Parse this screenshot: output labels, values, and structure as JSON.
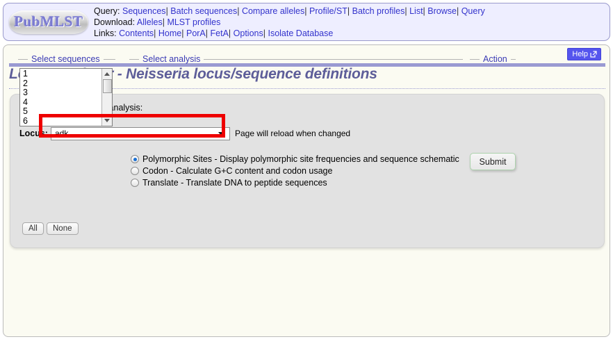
{
  "header": {
    "logo_text": "PubMLST",
    "rows": [
      {
        "label": "Query:",
        "links": [
          "Sequences",
          "Batch sequences",
          "Compare alleles",
          "Profile/ST",
          "Batch profiles",
          "List",
          "Browse",
          "Query"
        ]
      },
      {
        "label": "Download:",
        "links": [
          "Alleles",
          "MLST profiles"
        ]
      },
      {
        "label": "Links:",
        "links": [
          "Contents",
          "Home",
          "PorA",
          "FetA",
          "Options",
          "Isolate Database"
        ]
      }
    ],
    "separator": "|"
  },
  "help": {
    "label": "Help",
    "icon": "external-link-icon"
  },
  "page": {
    "title": "Locus Explorer - Neisseria locus/sequence definitions"
  },
  "form": {
    "instruction": "Please select locus for analysis:",
    "locus_label": "Locus:",
    "locus_value": "adk",
    "locus_options": [
      "adk"
    ],
    "reload_note": "Page will reload when changed"
  },
  "sequences": {
    "legend": "Select sequences",
    "items": [
      "1",
      "2",
      "3",
      "4",
      "5",
      "6"
    ],
    "all_label": "All",
    "none_label": "None"
  },
  "analysis": {
    "legend": "Select analysis",
    "options": [
      {
        "label": "Polymorphic Sites - Display polymorphic site frequencies and sequence schematic",
        "selected": true
      },
      {
        "label": "Codon - Calculate G+C content and codon usage",
        "selected": false
      },
      {
        "label": "Translate - Translate DNA to peptide sequences",
        "selected": false
      }
    ]
  },
  "action": {
    "legend": "Action",
    "submit_label": "Submit"
  },
  "colors": {
    "nav_background": "#eeeeff",
    "link": "#3333cc",
    "title": "#5d5d99",
    "highlight_box": "#ee0000",
    "help_button": "#5555ee"
  }
}
